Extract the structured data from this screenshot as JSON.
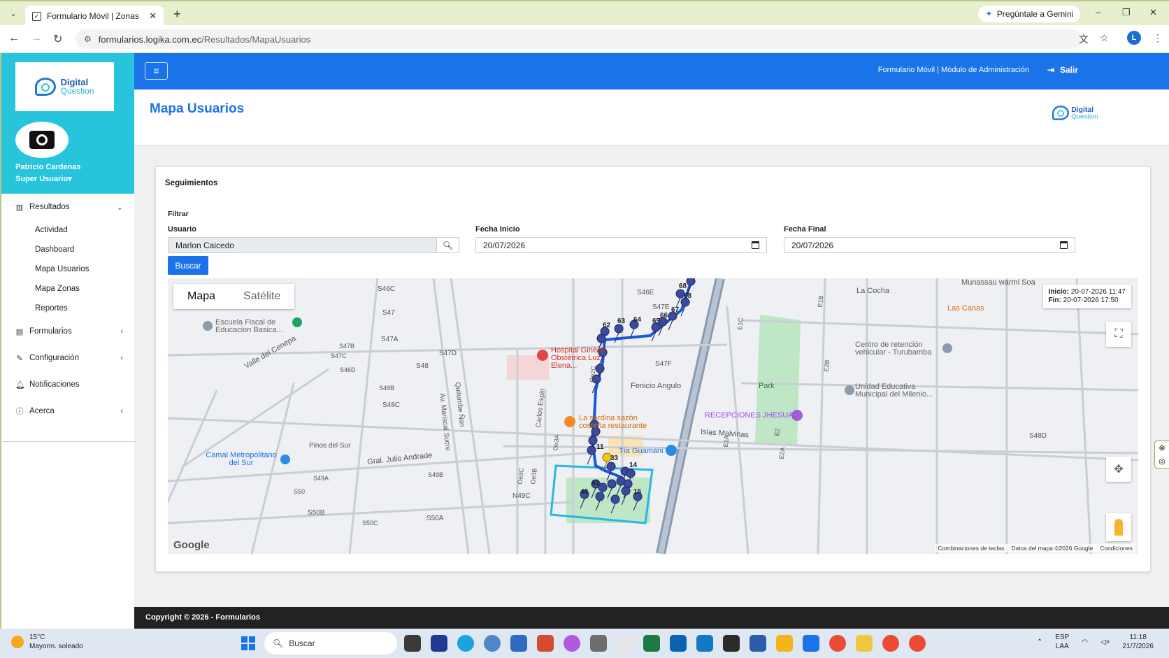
{
  "browser": {
    "tab_title": "Formulario Móvil | Zonas",
    "new_tab": "+",
    "tab_close": "✕",
    "gemini_label": "Pregúntale a Gemini",
    "url_host": "formularios.logika.com.ec",
    "url_path": "/Resultados/MapaUsuarios",
    "profile_initial": "L",
    "window_controls": [
      "–",
      "❐",
      "✕"
    ]
  },
  "sidebar": {
    "logo_line1": "Digital",
    "logo_line2": "Question",
    "user_name": "Patricio Cardenas",
    "user_role": "Super Usuario▾",
    "menu": {
      "resultados": "Resultados",
      "sub": [
        "Actividad",
        "Dashboard",
        "Mapa Usuarios",
        "Mapa Zonas",
        "Reportes"
      ],
      "formularios": "Formularios",
      "configuracion": "Configuración",
      "notificaciones": "Notificaciones",
      "acerca": "Acerca"
    }
  },
  "topnav": {
    "menu_icon": "≡",
    "breadcrumb": "Formulario Móvil | Módulo de Administración",
    "logout": "Salir"
  },
  "page": {
    "title": "Mapa Usuarios",
    "card_title": "Seguimientos",
    "filter_title": "Filtrar",
    "usuario_label": "Usuario",
    "usuario_value": "Marlon Caicedo",
    "fecha_inicio_label": "Fecha Inicio",
    "fecha_inicio_value": "20/07/2026",
    "fecha_final_label": "Fecha Final",
    "fecha_final_value": "20/07/2026",
    "buscar_label": "Buscar"
  },
  "map": {
    "toggle": [
      "Mapa",
      "Satélite"
    ],
    "legend_inicio_label": "Inicio:",
    "legend_inicio": "20-07-2026 11:47",
    "legend_fin_label": "Fin:",
    "legend_fin": "20-07-2026 17:50",
    "google": "Google",
    "attribution": [
      "Combinaciones de teclas",
      "Datos del mapa ©2026 Google",
      "Condiciones"
    ],
    "labels": [
      "Escuela Fiscal de Educacion Basica...",
      "Hospital Gineco Obstétrica Luz Elena...",
      "La sardina sazón costeña restaurante",
      "Tía Guamani",
      "RECEPCIONES JHESUA",
      "Centro de retención vehicular - Turubamba",
      "Unidad Educativa Municipal del Milenio...",
      "Camal Metropolitano del Sur",
      "Park",
      "La Cocha",
      "Las Canas",
      "Munassau warmi Soa",
      "Islas Malvinas",
      "Fenicio Angulo",
      "Gral. Julio Andrade",
      "Valle del Cenepa",
      "Pinos del Sur",
      "Av. Mariscal Sucre",
      "Quitumbe Ñan",
      "Carlos Espin",
      "S47",
      "S47A",
      "S47B",
      "S47C",
      "S47D",
      "S47E",
      "S47F",
      "S46C",
      "S46D",
      "S46E",
      "S48",
      "S48B",
      "S48C",
      "S48D",
      "S49A",
      "S49B",
      "S50",
      "S50A",
      "S50B",
      "S50C",
      "E1A",
      "E1B",
      "E1C",
      "E2",
      "E2A",
      "E2B",
      "N49C",
      "Oe3A",
      "Oe3C",
      "Oe3B",
      "Oe2C"
    ],
    "route_numbers": [
      "68",
      "58",
      "67",
      "66",
      "65",
      "63",
      "64",
      "62",
      "33",
      "14",
      "15",
      "41",
      "40",
      "11"
    ]
  },
  "footer": {
    "copyright": "Copyright © 2026 - Formularios"
  },
  "taskbar": {
    "temperature": "15°C",
    "weather": "Mayorm. soleado",
    "search": "Buscar",
    "lang1": "ESP",
    "lang2": "LAA",
    "time": "11:18",
    "date": "21/7/2026"
  },
  "colors": {
    "primary": "#1a73e8",
    "sidebar_header": "#27c4dc",
    "route": "#1a56db",
    "zone": "#27b7e6",
    "marker": "#3b4a9c"
  }
}
